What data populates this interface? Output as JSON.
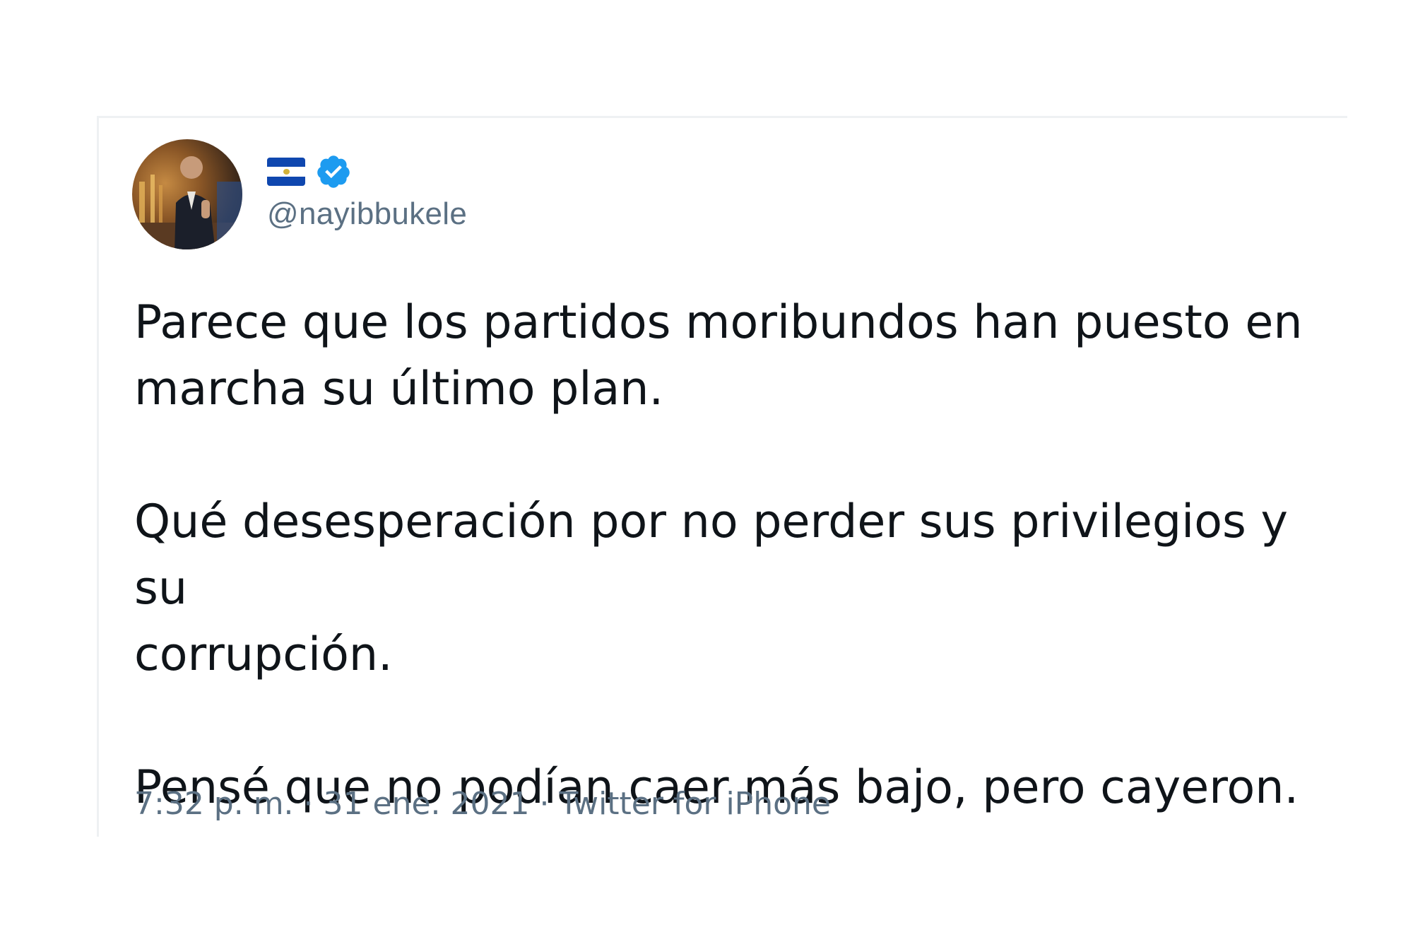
{
  "tweet": {
    "handle": "@nayibbukele",
    "paragraphs": [
      "Parece que los partidos moribundos han puesto en\nmarcha su último plan.",
      "Qué desesperación por no perder sus privilegios y su\ncorrupción.",
      "Pensé que no podían caer más bajo, pero cayeron."
    ],
    "time": "7:32 p. m.",
    "separator": "·",
    "date": "31 ene. 2021",
    "source": "Twitter for iPhone",
    "icons": {
      "flag": "el-salvador-flag-icon",
      "verified": "verified-badge-icon"
    },
    "colors": {
      "verified": "#1d9bf0",
      "secondary_text": "#5b7083",
      "primary_text": "#0f1419",
      "flag_blue": "#0f47af"
    }
  }
}
